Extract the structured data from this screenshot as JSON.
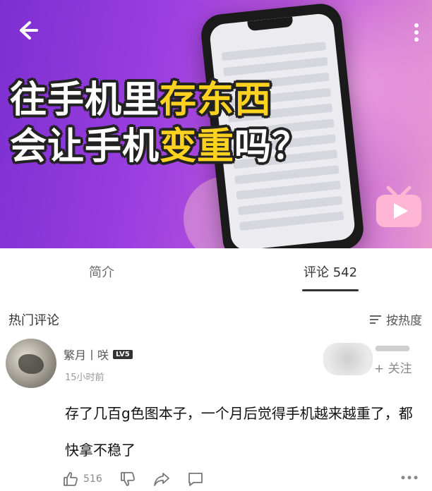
{
  "video": {
    "title_line1_white": "往手机里",
    "title_line1_yellow": "存东西",
    "title_line2_white_a": "会让手机",
    "title_line2_yellow": "变重",
    "title_line2_white_b": "吗？"
  },
  "tabs": {
    "intro": "简介",
    "comments": "评论 542"
  },
  "comments_section": {
    "heading": "热门评论",
    "sort_label": "按热度"
  },
  "comment": {
    "user": "繁月丨咲",
    "level": "LV5",
    "time": "15小时前",
    "follow": "+ 关注",
    "text": "存了几百g色图本子，一个月后觉得手机越来越重了，都快拿不稳了",
    "likes": "516"
  }
}
